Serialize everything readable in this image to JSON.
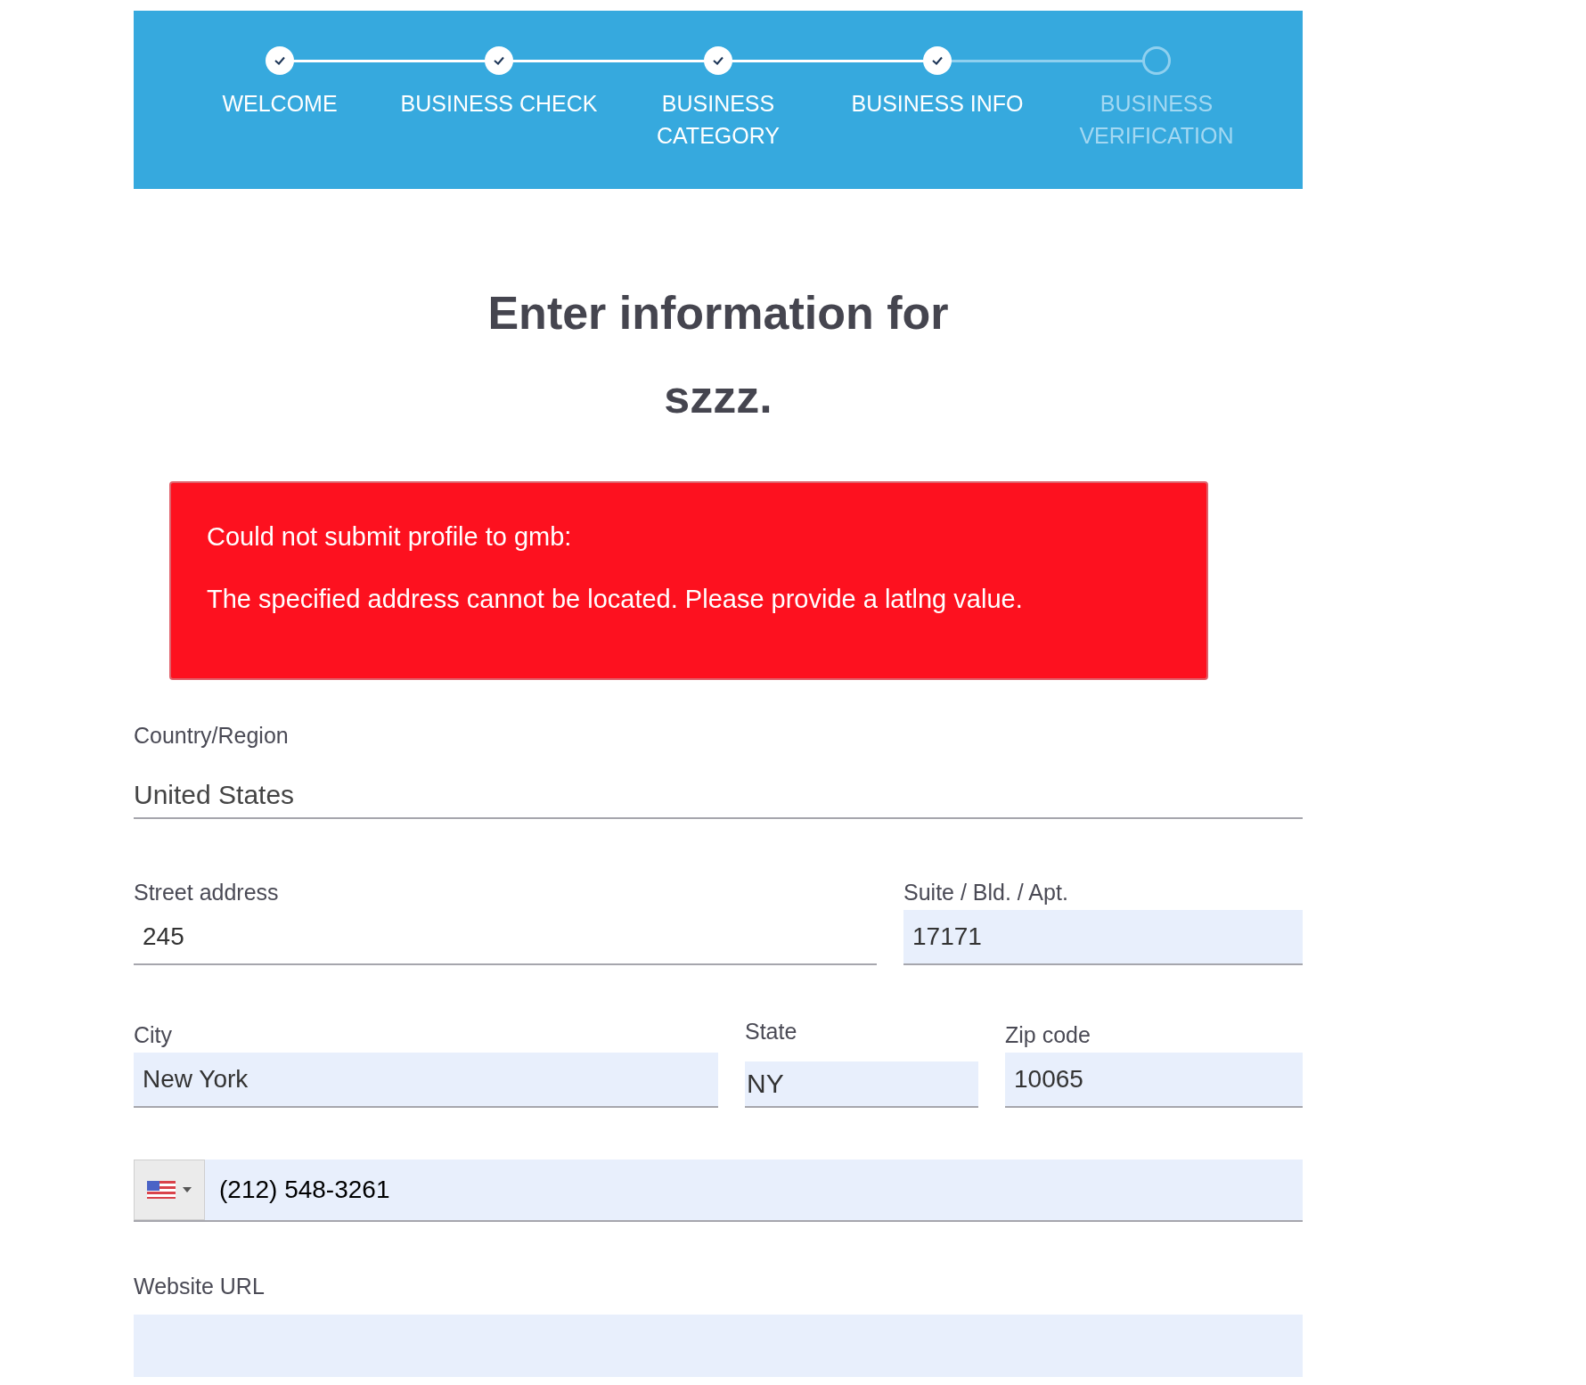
{
  "steps": [
    {
      "label": "WELCOME",
      "done": true
    },
    {
      "label": "BUSINESS CHECK",
      "done": true
    },
    {
      "label": "BUSINESS CATEGORY",
      "done": true
    },
    {
      "label": "BUSINESS INFO",
      "done": true
    },
    {
      "label": "BUSINESS VERIFICATION",
      "done": false
    }
  ],
  "heading": "Enter information for szzz.",
  "error": {
    "lines": [
      "Could not submit profile to gmb:",
      "The specified address cannot be located. Please provide a latlng value."
    ]
  },
  "country": {
    "label": "Country/Region",
    "value": "United States"
  },
  "street": {
    "label": "Street address",
    "value": "245"
  },
  "suite": {
    "label": "Suite / Bld. / Apt.",
    "value": "17171"
  },
  "city": {
    "label": "City",
    "value": "New York"
  },
  "state": {
    "label": "State",
    "value": "NY"
  },
  "zip": {
    "label": "Zip code",
    "value": "10065"
  },
  "phone": {
    "value": "(212) 548-3261"
  },
  "website": {
    "label": "Website URL"
  }
}
